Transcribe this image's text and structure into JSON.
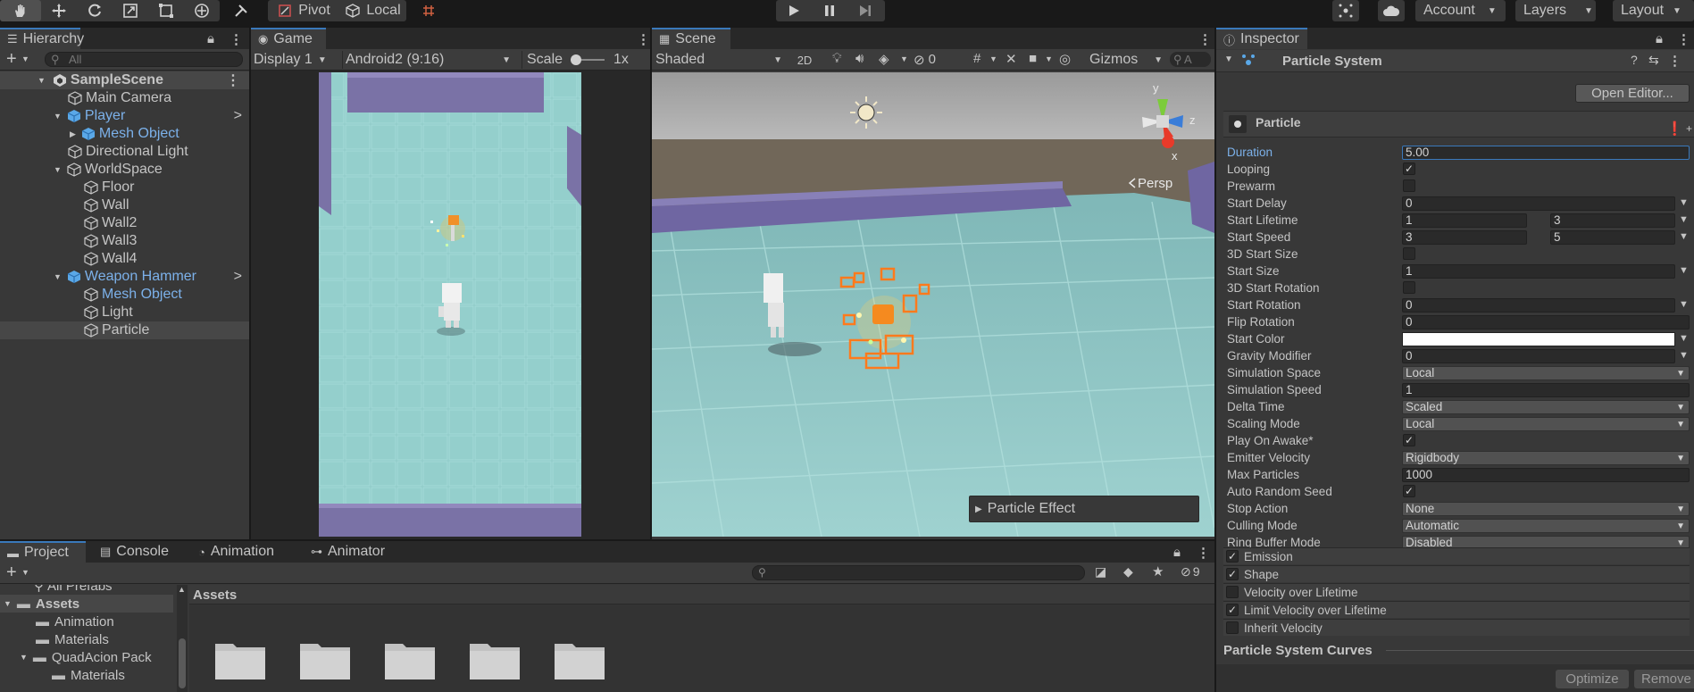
{
  "toolbar": {
    "pivot": "Pivot",
    "local": "Local",
    "account": "Account",
    "layers": "Layers",
    "layout": "Layout"
  },
  "hierarchy": {
    "tab": "Hierarchy",
    "search_placeholder": "All",
    "items": [
      {
        "label": "SampleScene"
      },
      {
        "label": "Main Camera"
      },
      {
        "label": "Player"
      },
      {
        "label": "Mesh Object"
      },
      {
        "label": "Directional Light"
      },
      {
        "label": "WorldSpace"
      },
      {
        "label": "Floor"
      },
      {
        "label": "Wall"
      },
      {
        "label": "Wall2"
      },
      {
        "label": "Wall3"
      },
      {
        "label": "Wall4"
      },
      {
        "label": "Weapon Hammer"
      },
      {
        "label": "Mesh Object"
      },
      {
        "label": "Light"
      },
      {
        "label": "Particle"
      }
    ]
  },
  "game": {
    "tab": "Game",
    "display": "Display 1",
    "aspect": "Android2 (9:16)",
    "scale_label": "Scale",
    "scale_value": "1x"
  },
  "scene": {
    "tab": "Scene",
    "shading": "Shaded",
    "mode_2d": "2D",
    "hidden_count": "0",
    "gizmos": "Gizmos",
    "search_placeholder": "A",
    "persp": "Persp",
    "axes": {
      "x": "x",
      "y": "y",
      "z": "z"
    },
    "particle_popup": "Particle Effect"
  },
  "inspector": {
    "tab": "Inspector",
    "component": "Particle System",
    "open_editor": "Open Editor...",
    "particle_name": "Particle",
    "properties": [
      {
        "label": "Duration",
        "value": "5.00"
      },
      {
        "label": "Looping",
        "checked": true
      },
      {
        "label": "Prewarm",
        "checked": false
      },
      {
        "label": "Start Delay",
        "value": "0"
      },
      {
        "label": "Start Lifetime",
        "value": "1",
        "value2": "3"
      },
      {
        "label": "Start Speed",
        "value": "3",
        "value2": "5"
      },
      {
        "label": "3D Start Size",
        "checked": false
      },
      {
        "label": "Start Size",
        "value": "1"
      },
      {
        "label": "3D Start Rotation",
        "checked": false
      },
      {
        "label": "Start Rotation",
        "value": "0"
      },
      {
        "label": "Flip Rotation",
        "value": "0"
      },
      {
        "label": "Start Color",
        "color": "#ffffff"
      },
      {
        "label": "Gravity Modifier",
        "value": "0"
      },
      {
        "label": "Simulation Space",
        "value": "Local"
      },
      {
        "label": "Simulation Speed",
        "value": "1"
      },
      {
        "label": "Delta Time",
        "value": "Scaled"
      },
      {
        "label": "Scaling Mode",
        "value": "Local"
      },
      {
        "label": "Play On Awake*",
        "checked": true
      },
      {
        "label": "Emitter Velocity",
        "value": "Rigidbody"
      },
      {
        "label": "Max Particles",
        "value": "1000"
      },
      {
        "label": "Auto Random Seed",
        "checked": true
      },
      {
        "label": "Stop Action",
        "value": "None"
      },
      {
        "label": "Culling Mode",
        "value": "Automatic"
      },
      {
        "label": "Ring Buffer Mode",
        "value": "Disabled"
      }
    ],
    "modules": [
      {
        "label": "Emission",
        "checked": true
      },
      {
        "label": "Shape",
        "checked": true
      },
      {
        "label": "Velocity over Lifetime",
        "checked": false
      },
      {
        "label": "Limit Velocity over Lifetime",
        "checked": true
      },
      {
        "label": "Inherit Velocity",
        "checked": false
      }
    ],
    "curves_title": "Particle System Curves",
    "optimize": "Optimize",
    "remove": "Remove"
  },
  "project": {
    "tabs": [
      "Project",
      "Console",
      "Animation",
      "Animator"
    ],
    "hidden_count": "9",
    "tree": [
      "All Prefabs",
      "Assets",
      "Animation",
      "Materials",
      "QuadAcion Pack",
      "Materials"
    ],
    "assets_title": "Assets"
  },
  "colors": {
    "selection_blue": "#3a79bb",
    "prefab_blue": "#7cb1ea",
    "floor": "#8cc7c6",
    "wall": "#7c73a8",
    "sky": "#a9a9a9",
    "ground": "#6b6157",
    "particle_orange": "#ff7b1c"
  }
}
